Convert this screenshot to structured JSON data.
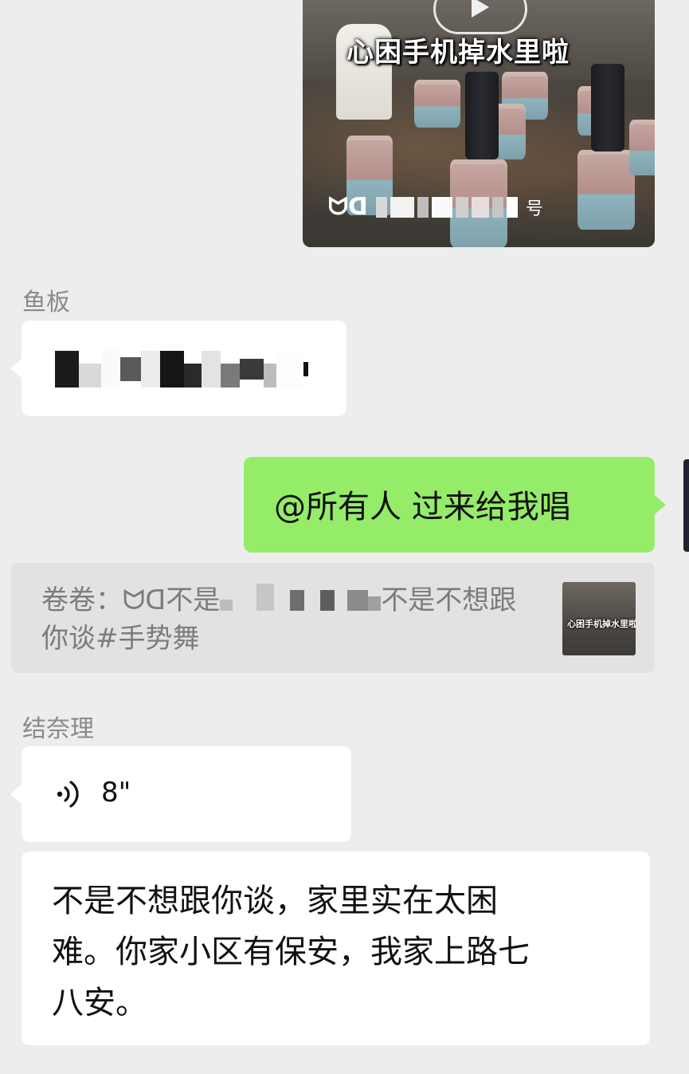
{
  "video_card": {
    "title": "心困手机掉水里啦",
    "channel_suffix": "号",
    "channel_logo": "ᗢᗡ"
  },
  "messages": {
    "msg1": {
      "sender": "鱼板"
    },
    "msg2": {
      "text": "@所有人 过来给我唱"
    },
    "quote": {
      "author": "卷卷：",
      "logo": "ᗢᗡ",
      "text_start": "不是",
      "text_mid": "不是不想跟",
      "text_end": "你谈#手势舞",
      "thumb_title": "心困手机掉水里啦"
    },
    "msg3": {
      "sender": "结奈理",
      "voice_duration": "8\""
    },
    "msg4": {
      "line1": "不是不想跟你谈，家里实在太困",
      "line2": "难。你家小区有保安，我家上路七",
      "line3": "八安。"
    }
  },
  "colors": {
    "background": "#ededed",
    "green_bubble": "#95ec69",
    "white_bubble": "#ffffff",
    "quote_bg": "#e2e2e2",
    "name_gray": "#8a8a8a"
  },
  "icons": [
    "play-icon",
    "channel-logo-icon",
    "voice-icon"
  ]
}
